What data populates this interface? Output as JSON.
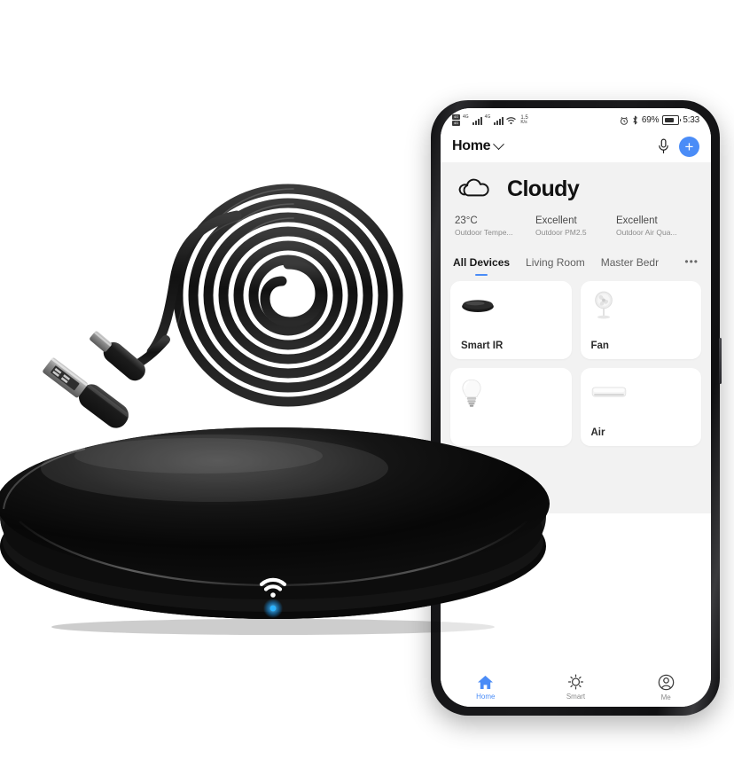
{
  "product": {
    "hub": {
      "name": "smart-ir-hub",
      "led_color": "#1e9bf0",
      "indicator_icon": "wifi-icon",
      "body_color": "#0a0a0a"
    },
    "cable": {
      "name": "usb-charging-cable",
      "color": "#1b1b1b",
      "connector_a": "usb-a",
      "connector_b": "micro-usb"
    }
  },
  "phone": {
    "statusbar": {
      "sim1": "4G",
      "sim2": "4G",
      "network_speed_value": "1.5",
      "network_speed_unit": "K/s",
      "battery_percent": "69%",
      "time": "5:33",
      "icons": [
        "sim-card-icon",
        "signal-bars-icon",
        "wifi-icon",
        "alarm-clock-icon",
        "bluetooth-icon",
        "battery-icon"
      ]
    },
    "appbar": {
      "home_label": "Home",
      "dropdown_icon": "chevron-down-icon",
      "mic_icon": "microphone-icon",
      "add_label": "+",
      "add_icon": "plus-icon",
      "accent_color": "#4a8cf7"
    },
    "weather": {
      "icon": "cloud-icon",
      "condition": "Cloudy",
      "stats": [
        {
          "value": "23°C",
          "label": "Outdoor Tempe..."
        },
        {
          "value": "Excellent",
          "label": "Outdoor PM2.5"
        },
        {
          "value": "Excellent",
          "label": "Outdoor Air Qua..."
        }
      ]
    },
    "tabs": {
      "items": [
        {
          "label": "All Devices",
          "active": true
        },
        {
          "label": "Living Room",
          "active": false
        },
        {
          "label": "Master Bedr",
          "active": false
        }
      ],
      "more_label": "•••"
    },
    "devices": [
      {
        "name": "Smart IR",
        "icon": "ir-hub-icon"
      },
      {
        "name": "Fan",
        "icon": "pedestal-fan-icon"
      },
      {
        "name": "",
        "icon": "light-bulb-icon"
      },
      {
        "name": "Air",
        "icon": "air-conditioner-icon"
      }
    ],
    "bottomnav": [
      {
        "label": "Home",
        "icon": "home-icon",
        "active": true
      },
      {
        "label": "Smart",
        "icon": "sun-icon",
        "active": false
      },
      {
        "label": "Me",
        "icon": "person-icon",
        "active": false
      }
    ]
  }
}
